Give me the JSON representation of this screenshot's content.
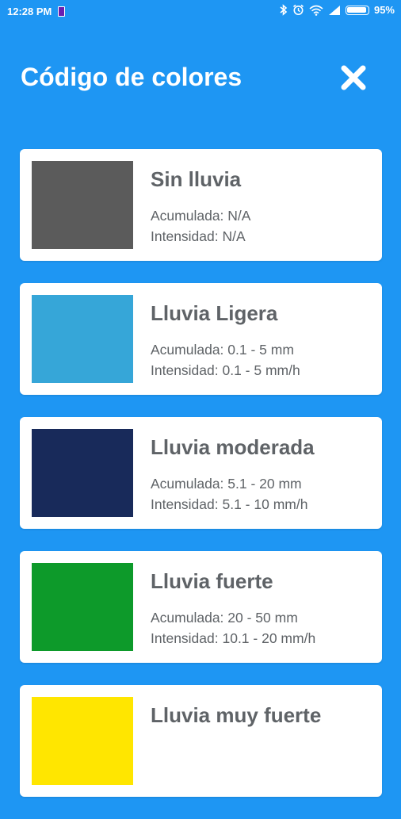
{
  "status_bar": {
    "time": "12:28 PM",
    "battery_percent": "95%",
    "battery_level": 0.95
  },
  "header": {
    "title": "Código de colores",
    "close_icon": "close-icon"
  },
  "colors": {
    "background": "#1e96f3",
    "card": "#ffffff",
    "text": "#5f6367"
  },
  "categories": [
    {
      "title": "Sin lluvia",
      "accumulated": "Acumulada: N/A",
      "intensity": "Intensidad: N/A",
      "color": "#5b5b5b"
    },
    {
      "title": "Lluvia Ligera",
      "accumulated": "Acumulada: 0.1 - 5 mm",
      "intensity": "Intensidad: 0.1 - 5 mm/h",
      "color": "#36a6d8"
    },
    {
      "title": "Lluvia moderada",
      "accumulated": "Acumulada: 5.1 - 20 mm",
      "intensity": "Intensidad: 5.1 - 10 mm/h",
      "color": "#182a5a"
    },
    {
      "title": "Lluvia fuerte",
      "accumulated": "Acumulada: 20 - 50 mm",
      "intensity": "Intensidad: 10.1 - 20 mm/h",
      "color": "#0d9a2a"
    },
    {
      "title": "Lluvia muy fuerte",
      "accumulated": "",
      "intensity": "",
      "color": "#ffe600"
    }
  ]
}
